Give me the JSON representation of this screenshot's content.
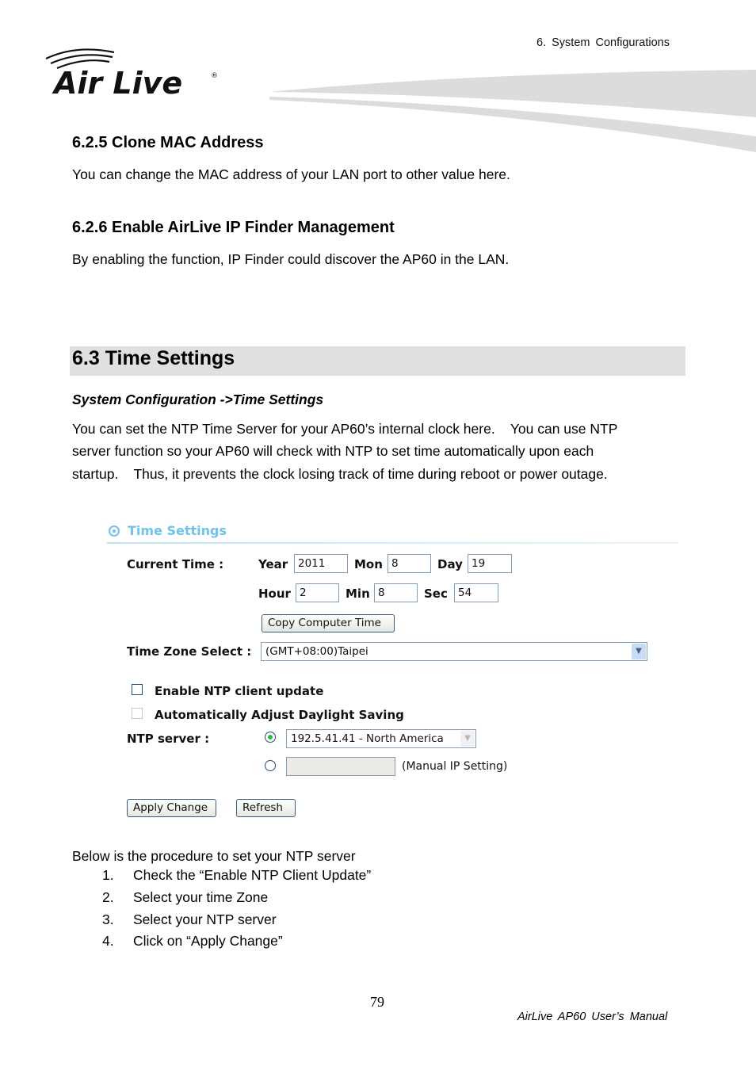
{
  "header": {
    "chapter": "6.  System  Configurations",
    "logo_text": "Air Live",
    "logo_registered": "®"
  },
  "sections": {
    "clone_mac": {
      "title": "6.2.5 Clone MAC Address",
      "body": "You can change the MAC address of your LAN port to other value here."
    },
    "ip_finder": {
      "title": "6.2.6 Enable AirLive IP Finder Management",
      "body": "By enabling the function, IP Finder could discover the AP60 in the LAN."
    },
    "time_settings": {
      "title": "6.3 Time Settings",
      "path": "System Configuration ->Time Settings",
      "body_lines": [
        "You can set the NTP Time Server for your AP60’s internal clock here.    You can use NTP",
        "server function so your AP60 will check with NTP to set time automatically upon each",
        "startup.    Thus, it prevents the clock losing track of time during reboot or power outage."
      ]
    }
  },
  "ui": {
    "panel_title": "Time Settings",
    "current_time_label": "Current Time :",
    "fields": {
      "year": {
        "label": "Year",
        "value": "2011"
      },
      "mon": {
        "label": "Mon",
        "value": "8"
      },
      "day": {
        "label": "Day",
        "value": "19"
      },
      "hour": {
        "label": "Hour",
        "value": "2"
      },
      "min": {
        "label": "Min",
        "value": "8"
      },
      "sec": {
        "label": "Sec",
        "value": "54"
      }
    },
    "copy_button": "Copy Computer Time",
    "timezone_label": "Time Zone Select :",
    "timezone_value": "(GMT+08:00)Taipei",
    "enable_ntp_label": "Enable NTP client update",
    "enable_ntp_checked": false,
    "daylight_label": "Automatically Adjust Daylight Saving",
    "daylight_checked": false,
    "ntp_server_label": "NTP server :",
    "ntp_server_value": "192.5.41.41 - North America",
    "manual_ip_value": "",
    "manual_ip_label": "(Manual IP Setting)",
    "apply_button": "Apply Change",
    "refresh_button": "Refresh"
  },
  "procedure": {
    "intro": "Below is the procedure to set your NTP server",
    "steps": [
      {
        "num": "1.",
        "text": "Check the “Enable NTP Client Update”"
      },
      {
        "num": "2.",
        "text": "Select your time Zone"
      },
      {
        "num": "3.",
        "text": "Select your NTP server"
      },
      {
        "num": "4.",
        "text": "Click on “Apply Change”"
      }
    ]
  },
  "footer": {
    "page_number": "79",
    "manual_title": "AirLive  AP60  User’s  Manual"
  }
}
